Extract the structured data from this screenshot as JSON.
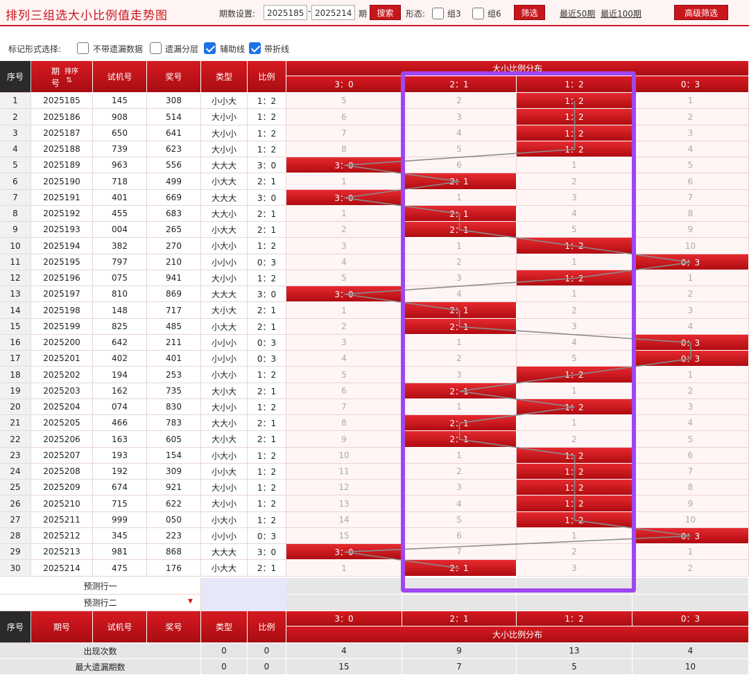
{
  "header": {
    "title": "排列三组选大小比例值走势图",
    "period_label": "期数设置:",
    "period_from": "2025185",
    "period_to": "2025214",
    "period_unit": "期",
    "search_btn": "搜索",
    "shape_label": "形态:",
    "group3": "组3",
    "group6": "组6",
    "filter_btn": "筛选",
    "recent50": "最近50期",
    "recent100": "最近100期",
    "advanced_btn": "高级筛选"
  },
  "marks": {
    "label": "标记形式选择:",
    "options": [
      {
        "label": "不带遗漏数据",
        "checked": false
      },
      {
        "label": "遗漏分层",
        "checked": false
      },
      {
        "label": "辅助线",
        "checked": true
      },
      {
        "label": "带折线",
        "checked": true
      }
    ]
  },
  "table": {
    "headers": {
      "seq": "序号",
      "issue_top": "期",
      "issue_bottom": "号",
      "sort": "排序",
      "trial": "试机号",
      "prize": "奖号",
      "type": "类型",
      "ratio": "比例",
      "dist_title": "大小比例分布"
    },
    "dist_cols": [
      "3：0",
      "2：1",
      "1：2",
      "0：3"
    ],
    "rows": [
      {
        "seq": "1",
        "issue": "2025185",
        "trial": "145",
        "prize": "308",
        "type": "小小大",
        "ratio": "1：2",
        "dist": [
          "5",
          "2",
          "1：2",
          "1"
        ],
        "hit": 2
      },
      {
        "seq": "2",
        "issue": "2025186",
        "trial": "908",
        "prize": "514",
        "type": "大小小",
        "ratio": "1：2",
        "dist": [
          "6",
          "3",
          "1：2",
          "2"
        ],
        "hit": 2
      },
      {
        "seq": "3",
        "issue": "2025187",
        "trial": "650",
        "prize": "641",
        "type": "大小小",
        "ratio": "1：2",
        "dist": [
          "7",
          "4",
          "1：2",
          "3"
        ],
        "hit": 2
      },
      {
        "seq": "4",
        "issue": "2025188",
        "trial": "739",
        "prize": "623",
        "type": "大小小",
        "ratio": "1：2",
        "dist": [
          "8",
          "5",
          "1：2",
          "4"
        ],
        "hit": 2
      },
      {
        "seq": "5",
        "issue": "2025189",
        "trial": "963",
        "prize": "556",
        "type": "大大大",
        "ratio": "3：0",
        "dist": [
          "3：0",
          "6",
          "1",
          "5"
        ],
        "hit": 0
      },
      {
        "seq": "6",
        "issue": "2025190",
        "trial": "718",
        "prize": "499",
        "type": "小大大",
        "ratio": "2：1",
        "dist": [
          "1",
          "2：1",
          "2",
          "6"
        ],
        "hit": 1
      },
      {
        "seq": "7",
        "issue": "2025191",
        "trial": "401",
        "prize": "669",
        "type": "大大大",
        "ratio": "3：0",
        "dist": [
          "3：0",
          "1",
          "3",
          "7"
        ],
        "hit": 0
      },
      {
        "seq": "8",
        "issue": "2025192",
        "trial": "455",
        "prize": "683",
        "type": "大大小",
        "ratio": "2：1",
        "dist": [
          "1",
          "2：1",
          "4",
          "8"
        ],
        "hit": 1
      },
      {
        "seq": "9",
        "issue": "2025193",
        "trial": "004",
        "prize": "265",
        "type": "小大大",
        "ratio": "2：1",
        "dist": [
          "2",
          "2：1",
          "5",
          "9"
        ],
        "hit": 1
      },
      {
        "seq": "10",
        "issue": "2025194",
        "trial": "382",
        "prize": "270",
        "type": "小大小",
        "ratio": "1：2",
        "dist": [
          "3",
          "1",
          "1：2",
          "10"
        ],
        "hit": 2
      },
      {
        "seq": "11",
        "issue": "2025195",
        "trial": "797",
        "prize": "210",
        "type": "小小小",
        "ratio": "0：3",
        "dist": [
          "4",
          "2",
          "1",
          "0：3"
        ],
        "hit": 3
      },
      {
        "seq": "12",
        "issue": "2025196",
        "trial": "075",
        "prize": "941",
        "type": "大小小",
        "ratio": "1：2",
        "dist": [
          "5",
          "3",
          "1：2",
          "1"
        ],
        "hit": 2
      },
      {
        "seq": "13",
        "issue": "2025197",
        "trial": "810",
        "prize": "869",
        "type": "大大大",
        "ratio": "3：0",
        "dist": [
          "3：0",
          "4",
          "1",
          "2"
        ],
        "hit": 0
      },
      {
        "seq": "14",
        "issue": "2025198",
        "trial": "148",
        "prize": "717",
        "type": "大小大",
        "ratio": "2：1",
        "dist": [
          "1",
          "2：1",
          "2",
          "3"
        ],
        "hit": 1
      },
      {
        "seq": "15",
        "issue": "2025199",
        "trial": "825",
        "prize": "485",
        "type": "小大大",
        "ratio": "2：1",
        "dist": [
          "2",
          "2：1",
          "3",
          "4"
        ],
        "hit": 1
      },
      {
        "seq": "16",
        "issue": "2025200",
        "trial": "642",
        "prize": "211",
        "type": "小小小",
        "ratio": "0：3",
        "dist": [
          "3",
          "1",
          "4",
          "0：3"
        ],
        "hit": 3
      },
      {
        "seq": "17",
        "issue": "2025201",
        "trial": "402",
        "prize": "401",
        "type": "小小小",
        "ratio": "0：3",
        "dist": [
          "4",
          "2",
          "5",
          "0：3"
        ],
        "hit": 3
      },
      {
        "seq": "18",
        "issue": "2025202",
        "trial": "194",
        "prize": "253",
        "type": "小大小",
        "ratio": "1：2",
        "dist": [
          "5",
          "3",
          "1：2",
          "1"
        ],
        "hit": 2
      },
      {
        "seq": "19",
        "issue": "2025203",
        "trial": "162",
        "prize": "735",
        "type": "大小大",
        "ratio": "2：1",
        "dist": [
          "6",
          "2：1",
          "1",
          "2"
        ],
        "hit": 1
      },
      {
        "seq": "20",
        "issue": "2025204",
        "trial": "074",
        "prize": "830",
        "type": "大小小",
        "ratio": "1：2",
        "dist": [
          "7",
          "1",
          "1：2",
          "3"
        ],
        "hit": 2
      },
      {
        "seq": "21",
        "issue": "2025205",
        "trial": "466",
        "prize": "783",
        "type": "大大小",
        "ratio": "2：1",
        "dist": [
          "8",
          "2：1",
          "1",
          "4"
        ],
        "hit": 1
      },
      {
        "seq": "22",
        "issue": "2025206",
        "trial": "163",
        "prize": "605",
        "type": "大小大",
        "ratio": "2：1",
        "dist": [
          "9",
          "2：1",
          "2",
          "5"
        ],
        "hit": 1
      },
      {
        "seq": "23",
        "issue": "2025207",
        "trial": "193",
        "prize": "154",
        "type": "小大小",
        "ratio": "1：2",
        "dist": [
          "10",
          "1",
          "1：2",
          "6"
        ],
        "hit": 2
      },
      {
        "seq": "24",
        "issue": "2025208",
        "trial": "192",
        "prize": "309",
        "type": "小小大",
        "ratio": "1：2",
        "dist": [
          "11",
          "2",
          "1：2",
          "7"
        ],
        "hit": 2
      },
      {
        "seq": "25",
        "issue": "2025209",
        "trial": "674",
        "prize": "921",
        "type": "大小小",
        "ratio": "1：2",
        "dist": [
          "12",
          "3",
          "1：2",
          "8"
        ],
        "hit": 2
      },
      {
        "seq": "26",
        "issue": "2025210",
        "trial": "715",
        "prize": "622",
        "type": "大小小",
        "ratio": "1：2",
        "dist": [
          "13",
          "4",
          "1：2",
          "9"
        ],
        "hit": 2
      },
      {
        "seq": "27",
        "issue": "2025211",
        "trial": "999",
        "prize": "050",
        "type": "小大小",
        "ratio": "1：2",
        "dist": [
          "14",
          "5",
          "1：2",
          "10"
        ],
        "hit": 2
      },
      {
        "seq": "28",
        "issue": "2025212",
        "trial": "345",
        "prize": "223",
        "type": "小小小",
        "ratio": "0：3",
        "dist": [
          "15",
          "6",
          "1",
          "0：3"
        ],
        "hit": 3
      },
      {
        "seq": "29",
        "issue": "2025213",
        "trial": "981",
        "prize": "868",
        "type": "大大大",
        "ratio": "3：0",
        "dist": [
          "3：0",
          "7",
          "2",
          "1"
        ],
        "hit": 0
      },
      {
        "seq": "30",
        "issue": "2025214",
        "trial": "475",
        "prize": "176",
        "type": "小大大",
        "ratio": "2：1",
        "dist": [
          "1",
          "2：1",
          "3",
          "2"
        ],
        "hit": 1
      }
    ],
    "predict1": "预测行一",
    "predict2": "预测行二",
    "stats": [
      {
        "label": "出现次数",
        "type": "0",
        "ratio": "0",
        "dist": [
          "4",
          "9",
          "13",
          "4"
        ]
      },
      {
        "label": "最大遗漏期数",
        "type": "0",
        "ratio": "0",
        "dist": [
          "15",
          "7",
          "5",
          "10"
        ]
      }
    ]
  }
}
